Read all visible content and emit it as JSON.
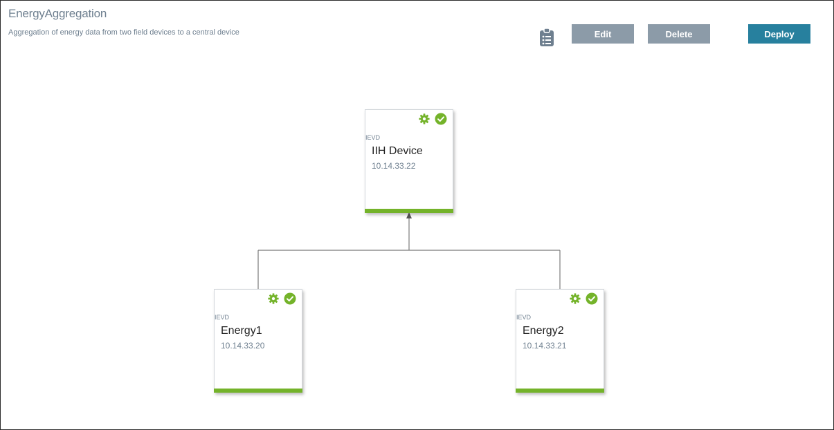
{
  "header": {
    "title": "EnergyAggregation",
    "description": "Aggregation of energy data from two field devices to a central device"
  },
  "toolbar": {
    "edit_label": "Edit",
    "delete_label": "Delete",
    "deploy_label": "Deploy",
    "details_icon": "clipboard-list-icon"
  },
  "colors": {
    "title_text": "#6e7f8f",
    "secondary_button": "#8c9ba8",
    "primary_button": "#27809e",
    "status_green": "#74b32a",
    "connector": "#7a7a7a"
  },
  "devices": [
    {
      "type": "IEVD",
      "name": "IIH Device",
      "ip": "10.14.33.22",
      "role": "central"
    },
    {
      "type": "IEVD",
      "name": "Energy1",
      "ip": "10.14.33.20",
      "role": "field"
    },
    {
      "type": "IEVD",
      "name": "Energy2",
      "ip": "10.14.33.21",
      "role": "field"
    }
  ]
}
